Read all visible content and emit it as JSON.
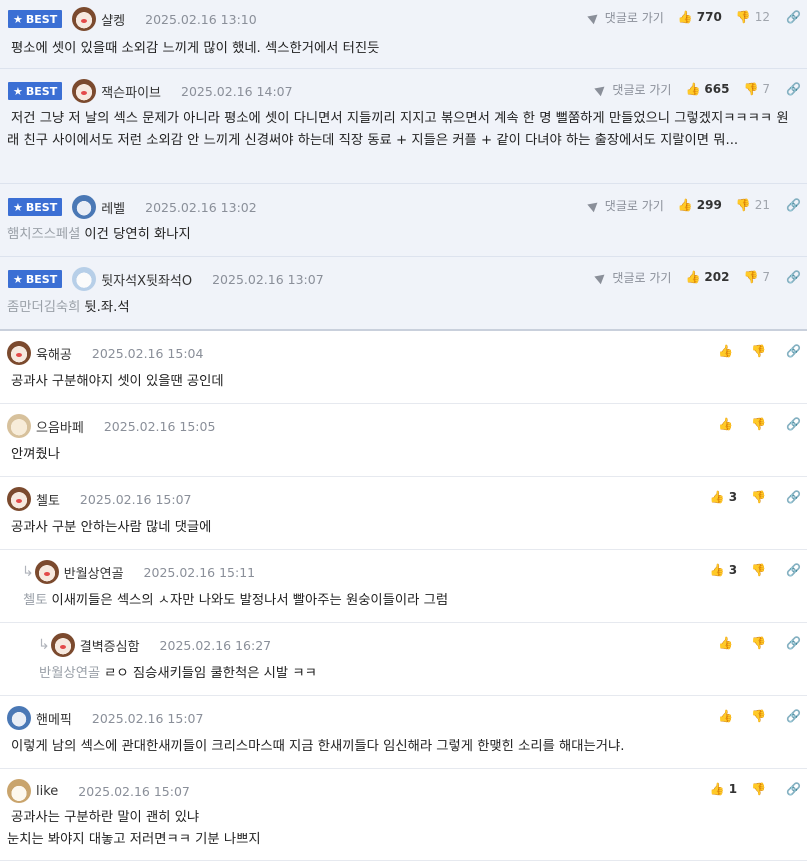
{
  "actions": {
    "goto_label": "댓글로 가기"
  },
  "comments": [
    {
      "best": true,
      "badge": "BEST",
      "nick": "샬켕",
      "date": "2025.02.16 13:10",
      "up": "770",
      "down": "12",
      "text": "평소에 셋이 있을때 소외감 느끼게 많이 했네. 섹스한거에서 터진듯",
      "ref": ""
    },
    {
      "best": true,
      "badge": "BEST",
      "nick": "잭슨파이브",
      "date": "2025.02.16 14:07",
      "up": "665",
      "down": "7",
      "text": "저건 그냥 저 날의 섹스 문제가 아니라 평소에 셋이 다니면서 지들끼리 지지고 볶으면서 계속 한 명 뻘쭘하게 만들었으니 그렇겠지ㅋㅋㅋㅋ 원래 친구 사이에서도 저런 소외감 안 느끼게 신경써야 하는데 직장 동료 + 지들은 커플 + 같이 다녀야 하는 출장에서도 지랄이면 뭐...",
      "ref": ""
    },
    {
      "best": true,
      "badge": "BEST",
      "nick": "레벨",
      "date": "2025.02.16 13:02",
      "up": "299",
      "down": "21",
      "text": "이건 당연히 화나지",
      "ref": "햄치즈스페셜"
    },
    {
      "best": true,
      "badge": "BEST",
      "nick": "뒷자석X뒷좌석O",
      "date": "2025.02.16 13:07",
      "up": "202",
      "down": "7",
      "text": "뒷.좌.석",
      "ref": "좀만더김숙희"
    },
    {
      "best": false,
      "nick": "육해공",
      "date": "2025.02.16 15:04",
      "up": "",
      "down": "",
      "text": "공과사 구분해야지 셋이 있을땐 공인데",
      "ref": ""
    },
    {
      "best": false,
      "nick": "으음바페",
      "date": "2025.02.16 15:05",
      "up": "",
      "down": "",
      "text": "안껴줬나",
      "ref": ""
    },
    {
      "best": false,
      "nick": "첼토",
      "date": "2025.02.16 15:07",
      "up": "3",
      "down": "",
      "text": "공과사 구분 안하는사람 많네 댓글에",
      "ref": ""
    },
    {
      "best": false,
      "nick": "반월상연골",
      "date": "2025.02.16 15:11",
      "up": "3",
      "down": "",
      "text": "이새끼들은 섹스의 ㅅ자만 나와도 발정나서 빨아주는 원숭이들이라 그럼",
      "ref": "첼토"
    },
    {
      "best": false,
      "nick": "결벽증심함",
      "date": "2025.02.16 16:27",
      "up": "",
      "down": "",
      "text": "ㄹㅇ 짐승새키들임 쿨한척은 시발 ㅋㅋ",
      "ref": "반월상연골"
    },
    {
      "best": false,
      "nick": "핸메픽",
      "date": "2025.02.16 15:07",
      "up": "",
      "down": "",
      "text": "이렇게 남의 섹스에 관대한새끼들이 크리스마스때 지금 한새끼들다 임신해라 그렇게 한맺힌 소리를 해대는거냐.",
      "ref": ""
    },
    {
      "best": false,
      "nick": "like",
      "date": "2025.02.16 15:07",
      "up": "1",
      "down": "",
      "text": "공과사는 구분하란 말이 괜히 있냐\n눈치는 봐야지 대놓고 저러면ㅋㅋ 기분 나쁘지",
      "ref": ""
    }
  ]
}
